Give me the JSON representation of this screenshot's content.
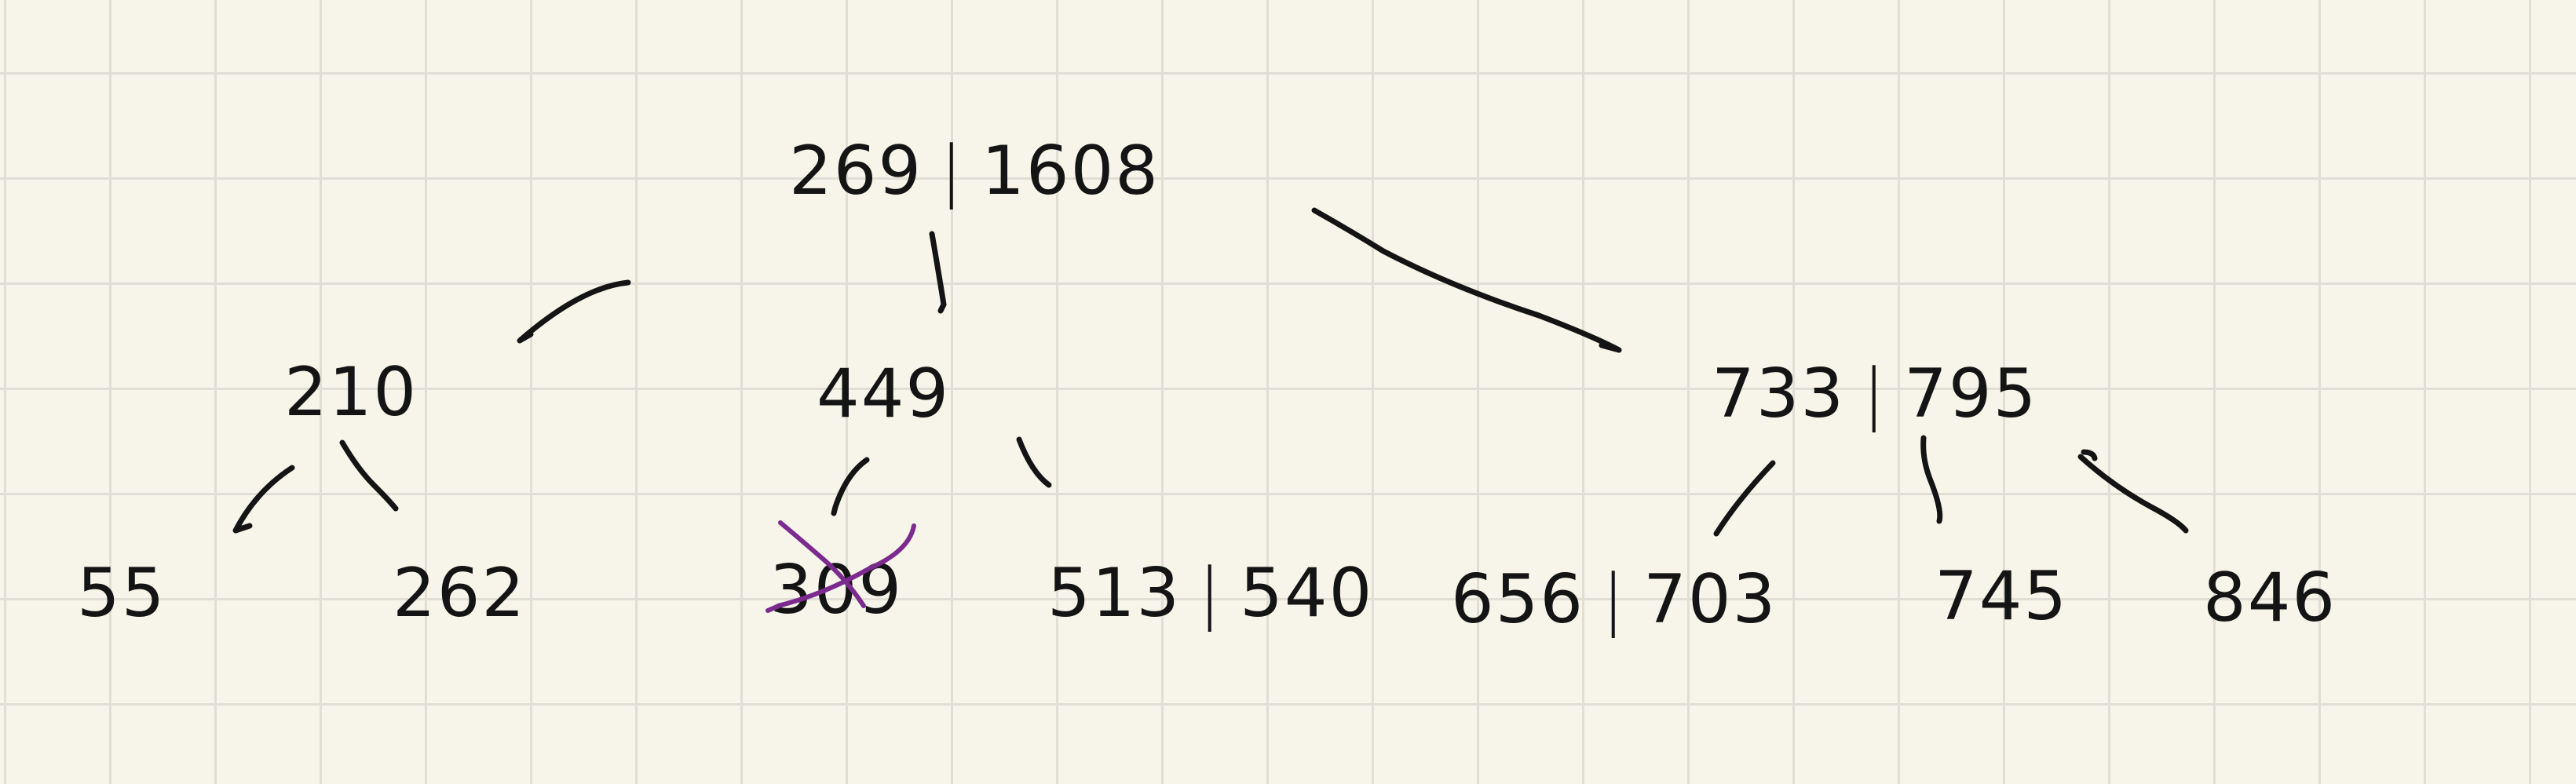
{
  "style": {
    "paper": "#f7f5ea",
    "grid": "#e0ded5",
    "ink": "#141414",
    "strike": "#7b2a8e"
  },
  "tree": {
    "root": {
      "keys": [
        "269",
        "1608"
      ]
    },
    "level1": [
      {
        "keys": [
          "210"
        ]
      },
      {
        "keys": [
          "449"
        ]
      },
      {
        "keys": [
          "733",
          "795"
        ]
      }
    ],
    "leaves": [
      {
        "keys": [
          "55"
        ]
      },
      {
        "keys": [
          "262"
        ]
      },
      {
        "keys": [
          "309"
        ],
        "struck_out": true
      },
      {
        "keys": [
          "513",
          "540"
        ]
      },
      {
        "keys": [
          "656",
          "703"
        ]
      },
      {
        "keys": [
          "745"
        ]
      },
      {
        "keys": [
          "846"
        ]
      }
    ]
  }
}
